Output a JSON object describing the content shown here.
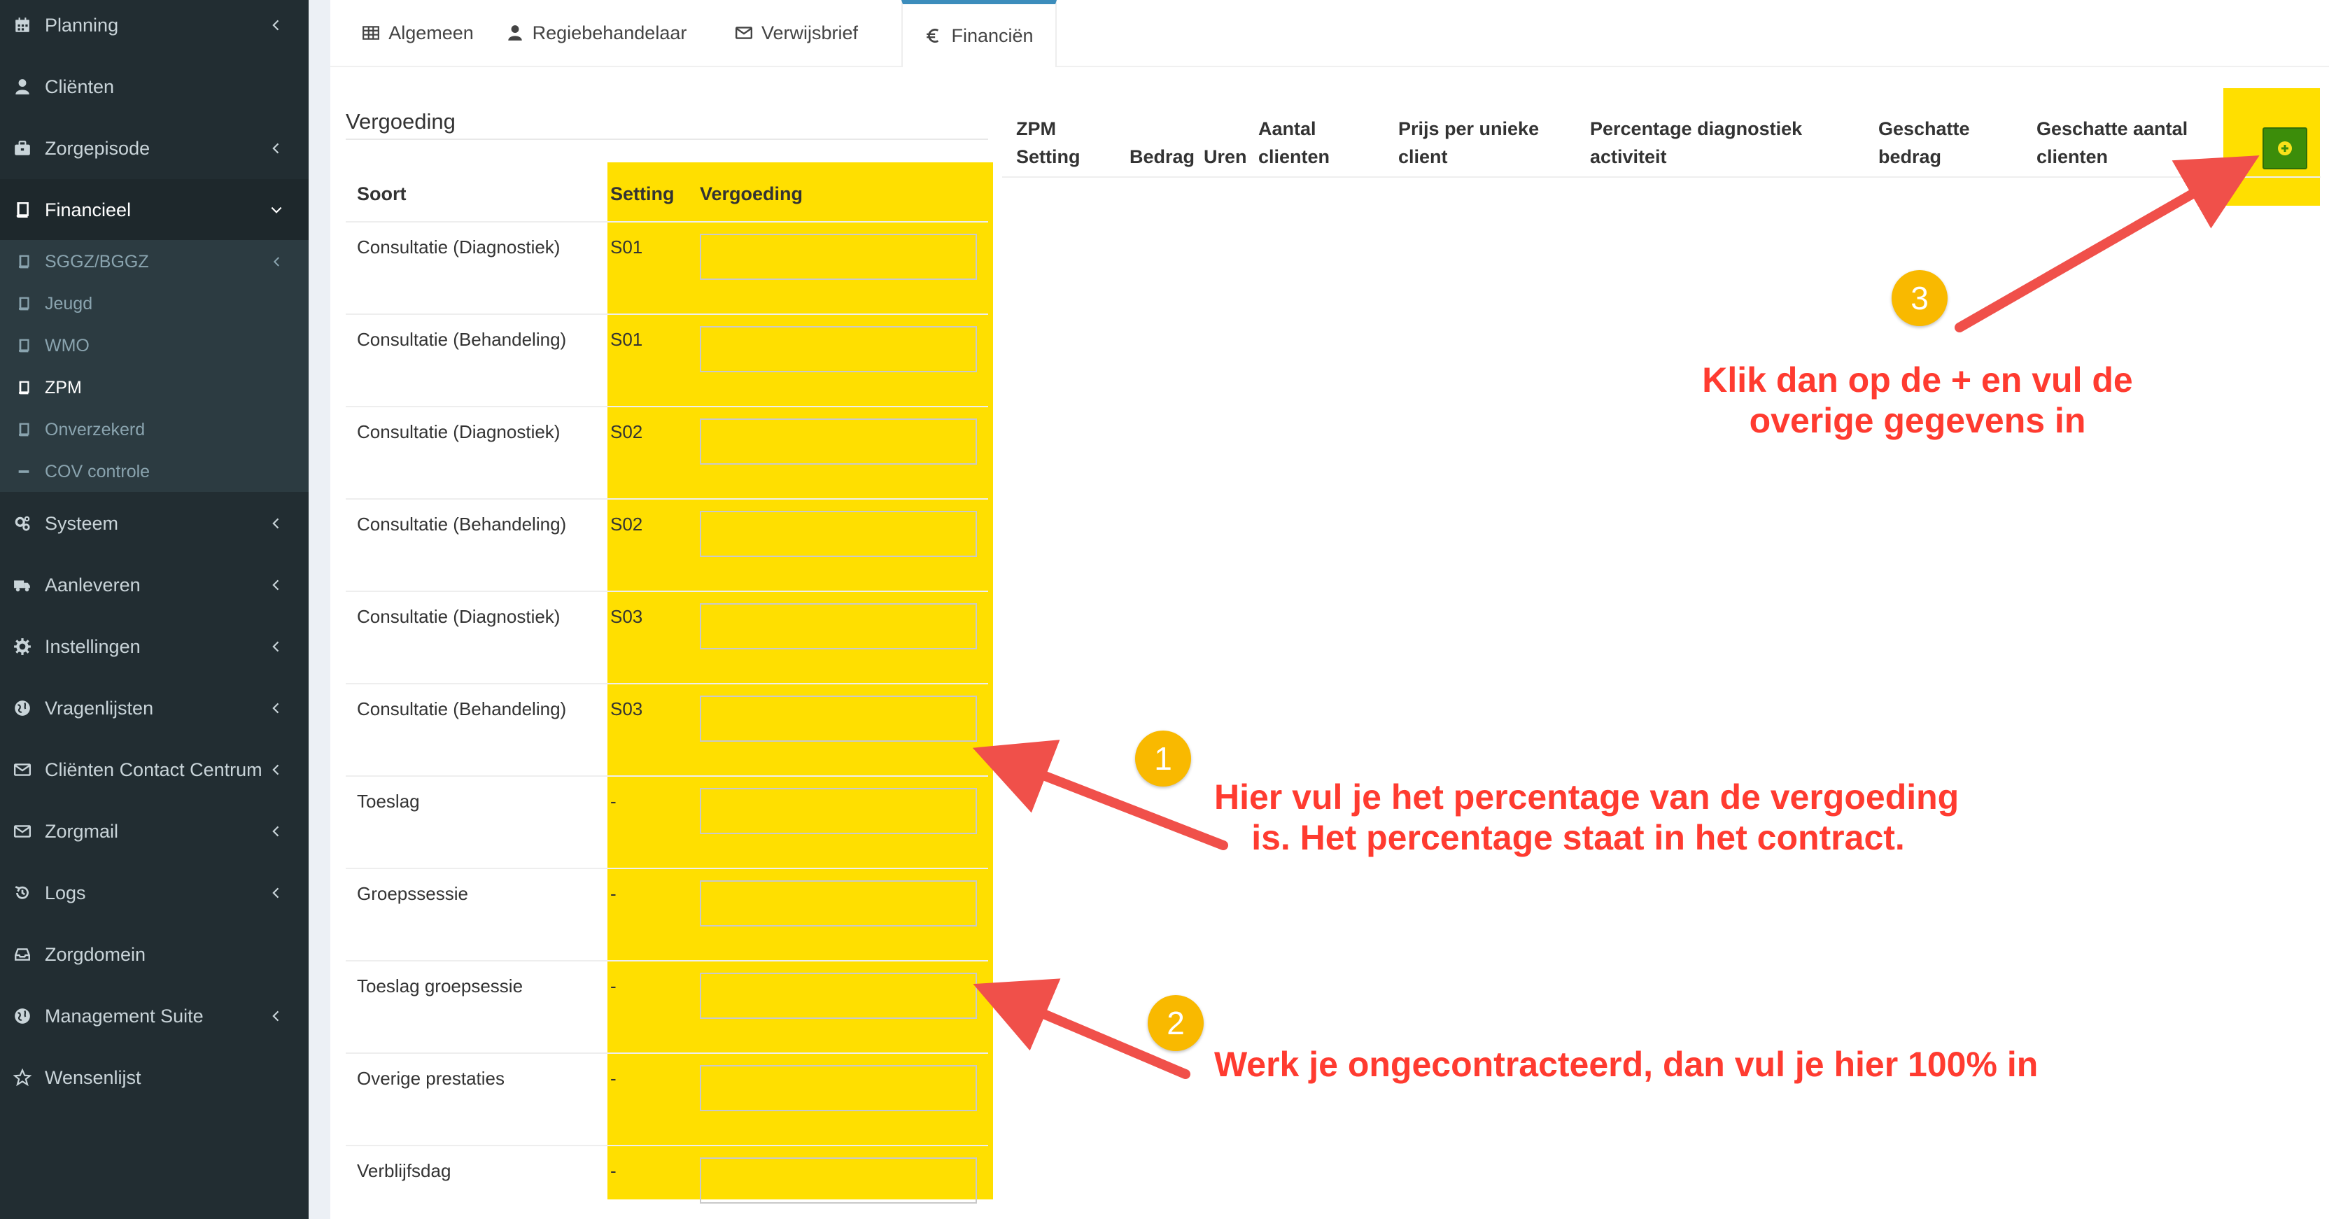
{
  "sidebar": {
    "items": [
      {
        "label": "Planning",
        "icon": "calendar-icon",
        "chevron": true
      },
      {
        "label": "Cliënten",
        "icon": "user-icon",
        "chevron": false
      },
      {
        "label": "Zorgepisode",
        "icon": "briefcase-icon",
        "chevron": true
      },
      {
        "label": "Financieel",
        "icon": "book-icon",
        "chevron": true,
        "expanded": true
      },
      {
        "label": "Systeem",
        "icon": "cogs-icon",
        "chevron": true
      },
      {
        "label": "Aanleveren",
        "icon": "truck-icon",
        "chevron": true
      },
      {
        "label": "Instellingen",
        "icon": "gear-icon",
        "chevron": true
      },
      {
        "label": "Vragenlijsten",
        "icon": "globe-icon",
        "chevron": true
      },
      {
        "label": "Cliënten Contact Centrum",
        "icon": "envelope-icon",
        "chevron": true
      },
      {
        "label": "Zorgmail",
        "icon": "envelope-icon",
        "chevron": true
      },
      {
        "label": "Logs",
        "icon": "history-icon",
        "chevron": true
      },
      {
        "label": "Zorgdomein",
        "icon": "inbox-icon",
        "chevron": false
      },
      {
        "label": "Management Suite",
        "icon": "globe-icon",
        "chevron": true
      },
      {
        "label": "Wensenlijst",
        "icon": "star-icon",
        "chevron": false
      }
    ],
    "subitems": [
      {
        "label": "SGGZ/BGGZ",
        "icon": "book-icon",
        "chevron": true
      },
      {
        "label": "Jeugd",
        "icon": "book-icon",
        "chevron": false
      },
      {
        "label": "WMO",
        "icon": "book-icon",
        "chevron": false
      },
      {
        "label": "ZPM",
        "icon": "book-icon",
        "chevron": false,
        "active": true
      },
      {
        "label": "Onverzekerd",
        "icon": "book-icon",
        "chevron": false
      },
      {
        "label": "COV controle",
        "icon": "minus-icon",
        "chevron": false
      }
    ]
  },
  "tabs": [
    {
      "label": "Algemeen",
      "icon": "table-icon"
    },
    {
      "label": "Regiebehandelaar",
      "icon": "user-icon"
    },
    {
      "label": "Verwijsbrief",
      "icon": "envelope-icon"
    },
    {
      "label": "Financiën",
      "icon": "euro-icon",
      "active": true
    }
  ],
  "vergoeding": {
    "title": "Vergoeding",
    "headers": {
      "soort": "Soort",
      "setting": "Setting",
      "vergoeding": "Vergoeding"
    },
    "rows": [
      {
        "soort": "Consultatie (Diagnostiek)",
        "setting": "S01",
        "value": ""
      },
      {
        "soort": "Consultatie (Behandeling)",
        "setting": "S01",
        "value": ""
      },
      {
        "soort": "Consultatie (Diagnostiek)",
        "setting": "S02",
        "value": ""
      },
      {
        "soort": "Consultatie (Behandeling)",
        "setting": "S02",
        "value": ""
      },
      {
        "soort": "Consultatie (Diagnostiek)",
        "setting": "S03",
        "value": ""
      },
      {
        "soort": "Consultatie (Behandeling)",
        "setting": "S03",
        "value": ""
      },
      {
        "soort": "Toeslag",
        "setting": "-",
        "value": ""
      },
      {
        "soort": "Groepssessie",
        "setting": "-",
        "value": ""
      },
      {
        "soort": "Toeslag groepsessie",
        "setting": "-",
        "value": ""
      },
      {
        "soort": "Overige prestaties",
        "setting": "-",
        "value": ""
      },
      {
        "soort": "Verblijfsdag",
        "setting": "-",
        "value": ""
      }
    ]
  },
  "zpm_table": {
    "headers": [
      [
        "ZPM",
        "Setting"
      ],
      [
        "",
        "Bedrag"
      ],
      [
        "",
        "Uren"
      ],
      [
        "Aantal",
        "clienten"
      ],
      [
        "Prijs per unieke",
        "client"
      ],
      [
        "Percentage diagnostiek",
        "activiteit"
      ],
      [
        "Geschatte",
        "bedrag"
      ],
      [
        "Geschatte aantal",
        "clienten"
      ]
    ],
    "add_button_icon": "plus-circle-icon"
  },
  "annotations": {
    "one": {
      "number": "1",
      "line1": "Hier vul je het percentage van de vergoeding",
      "line2": "is. Het percentage staat in het contract."
    },
    "two": {
      "number": "2",
      "line1": "Werk je ongecontracteerd, dan vul je hier 100% in"
    },
    "three": {
      "number": "3",
      "line1": "Klik dan op de + en vul de",
      "line2": "overige gegevens in"
    }
  },
  "colors": {
    "sidebar_bg": "#222d32",
    "highlight": "#ffdf00",
    "annotation_red": "#ff3b30",
    "badge": "#f9b900",
    "add_button": "#3c8d0a",
    "tab_accent": "#3c8dbc"
  }
}
